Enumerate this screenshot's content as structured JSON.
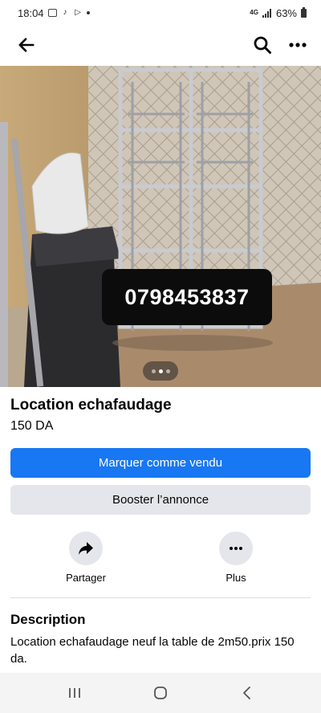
{
  "status_bar": {
    "time": "18:04",
    "network": "4G",
    "battery": "63%"
  },
  "app_bar": {
    "back_icon": "arrow-left-icon",
    "search_icon": "search-icon",
    "more_icon": "more-horizontal-icon"
  },
  "listing": {
    "phone_overlay": "0798453837",
    "photo_pages": 3,
    "photo_active_page": 2,
    "title": "Location echafaudage",
    "price": "150 DA"
  },
  "buttons": {
    "mark_sold": "Marquer comme vendu",
    "boost": "Booster l’annonce"
  },
  "actions": {
    "share_label": "Partager",
    "more_label": "Plus"
  },
  "description": {
    "heading": "Description",
    "text": "Location echafaudage neuf la table de 2m50.prix 150 da."
  },
  "colors": {
    "primary": "#1877f2",
    "secondary_bg": "#e4e6eb"
  }
}
